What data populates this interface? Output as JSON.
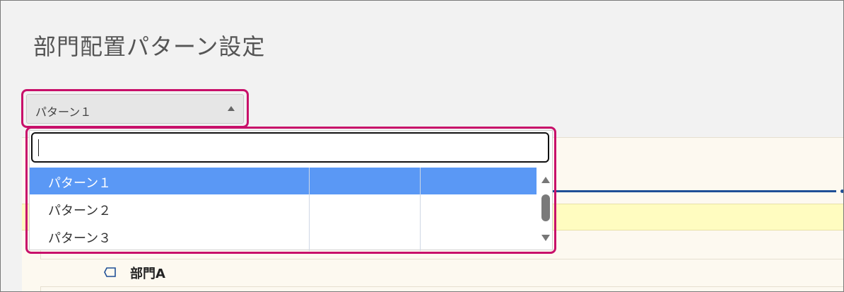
{
  "page": {
    "title": "部門配置パターン設定"
  },
  "select": {
    "value": "パターン１",
    "arrow_icon": "triangle-up-icon"
  },
  "dropdown": {
    "search_value": "",
    "items": [
      {
        "label": "パターン１",
        "selected": true
      },
      {
        "label": "パターン２",
        "selected": false
      },
      {
        "label": "パターン３",
        "selected": false
      }
    ]
  },
  "tree": {
    "dept_label": "部門A",
    "dept_icon": "department-tag-icon"
  },
  "colors": {
    "highlight": "#c8106a",
    "selected_row": "#5a98f5",
    "accent_line": "#1f4f96",
    "yellow_band": "#fffcc0"
  }
}
